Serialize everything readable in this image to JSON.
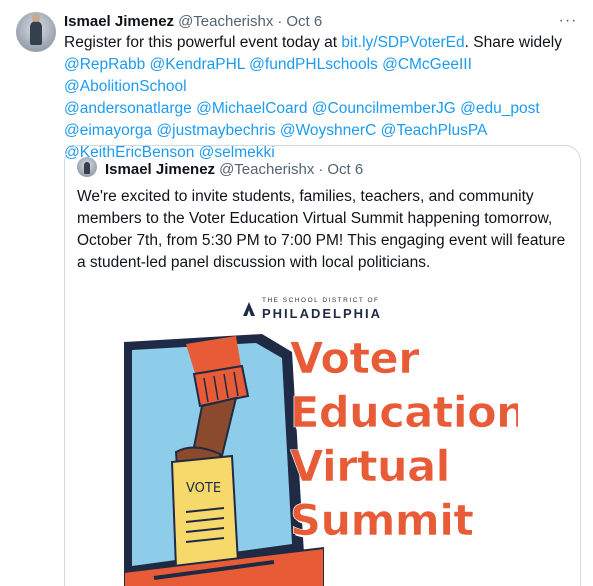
{
  "tweet": {
    "author_name": "Ismael Jimenez",
    "author_handle": "@Teacherishx",
    "separator": "·",
    "date": "Oct 6",
    "more_label": "···",
    "text_before_link": "Register for this powerful event today at ",
    "link": "bit.ly/SDPVoterEd",
    "text_after_link": ". Share widely",
    "mentions": [
      "@RepRabb",
      "@KendraPHL",
      "@fundPHLschools",
      "@CMcGeeIII",
      "@AbolitionSchool",
      "@andersonatlarge",
      "@MichaelCoard",
      "@CouncilmemberJG",
      "@edu_post",
      "@eimayorga",
      "@justmaybechris",
      "@WoyshnerC",
      "@TeachPlusPA",
      "@KeithEricBenson",
      "@selmekki"
    ]
  },
  "quoted": {
    "author_name": "Ismael Jimenez",
    "author_handle": "@Teacherishx",
    "separator": "·",
    "date": "Oct 6",
    "text": "We're excited to invite students, families, teachers, and community members to the Voter Education Virtual Summit happening tomorrow, October 7th, from 5:30 PM to 7:00 PM! This engaging event will feature a student-led panel discussion with local politicians.",
    "image": {
      "district_small": "THE SCHOOL DISTRICT OF",
      "district_big": "PHILADELPHIA",
      "title_lines": [
        "Voter",
        "Education",
        "Virtual",
        "Summit"
      ],
      "ballot_label": "VOTE"
    }
  },
  "colors": {
    "link": "#1d9bf0",
    "secondary_text": "#536471",
    "border": "#cfd9de",
    "title_orange": "#e85b37",
    "poster_blue": "#8ecdea",
    "poster_navy": "#1f2a44",
    "ballot_yellow": "#f6d86b",
    "sleeve_orange": "#e85b37"
  }
}
